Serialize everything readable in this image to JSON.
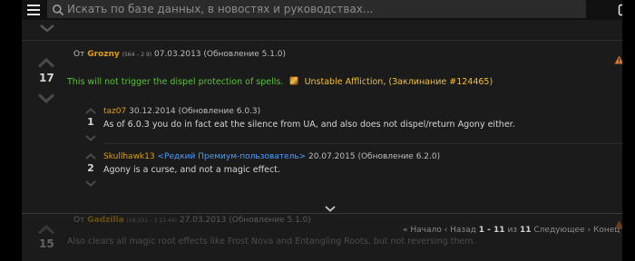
{
  "search": {
    "placeholder": "Искать по базе данных, в новостях и руководствах..."
  },
  "comment1": {
    "prefix": "От",
    "author": "Grozny",
    "rep": "(564 – 2 9)",
    "date": "07.03.2013 (Обновление 5.1.0)",
    "score": "17",
    "text_green": "This will not trigger the dispel protection of spells.",
    "spell_name": "Unstable Affliction, (Заклинание #124465)"
  },
  "reply1": {
    "author": "taz07",
    "date": "30.12.2014 (Обновление 6.0.3)",
    "score": "1",
    "text": "As of 6.0.3 you do in fact eat the silence from UA, and also does not dispel/return Agony either."
  },
  "reply2": {
    "author": "Skullhawk13",
    "badge": "<Редкий Премиум-пользователь>",
    "date": "20.07.2015 (Обновление 6.2.0)",
    "score": "2",
    "text": "Agony is a curse, and not a magic effect."
  },
  "comment2": {
    "prefix": "От",
    "author": "Gadzilla",
    "rep": "(18,331 – 3 21 44)",
    "date": "27.03.2013 (Обновление 5.1.0)",
    "score": "15",
    "text": "Also clears all magic root effects like Frost Nova and Entangling Roots, but not reversing them."
  },
  "pager": {
    "first": "« Начало",
    "prev": "‹ Назад",
    "range": "1 - 11",
    "of": "из",
    "total": "11",
    "next": "Следующее ›",
    "last": "Конец »"
  },
  "colors": {
    "author": "#e0a000",
    "green": "#59c235",
    "gold": "#f0c030",
    "premium": "#4a9eff",
    "warning": "#e8731e"
  },
  "icons": [
    "menu-icon",
    "search-icon",
    "share-icon",
    "chevron-up-icon",
    "chevron-down-icon",
    "warning-icon",
    "spell-icon"
  ]
}
